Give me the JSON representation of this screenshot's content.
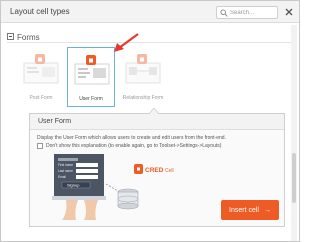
{
  "header": {
    "title": "Layout cell types",
    "search_placeholder": "Search..."
  },
  "section": {
    "title": "Forms"
  },
  "cards": [
    {
      "label": "Post Form",
      "selected": false
    },
    {
      "label": "User Form",
      "selected": true
    },
    {
      "label": "Relationship Form",
      "selected": false
    }
  ],
  "description": {
    "title": "User Form",
    "text": "Display the User Form which allows users to create and edit users from the front-end.",
    "checkbox_label": "Don't show this explanation (to enable again, go to Toolset->Settings->Layouts)",
    "illustration": {
      "label_name": "First name",
      "label_last": "Last name",
      "label_email": "Email",
      "signup": "Signup"
    },
    "cred_logo_text": "CRED",
    "cred_suffix": "Cell"
  },
  "button": {
    "insert_label": "Insert cell",
    "insert_arrow": "→"
  },
  "colors": {
    "accent": "#ef5b24",
    "selected_border": "#69b2de",
    "annotation_arrow": "#e53935"
  },
  "icons": {
    "search": "search-icon",
    "close": "close-icon",
    "form_badge": "lock-badge-icon"
  }
}
